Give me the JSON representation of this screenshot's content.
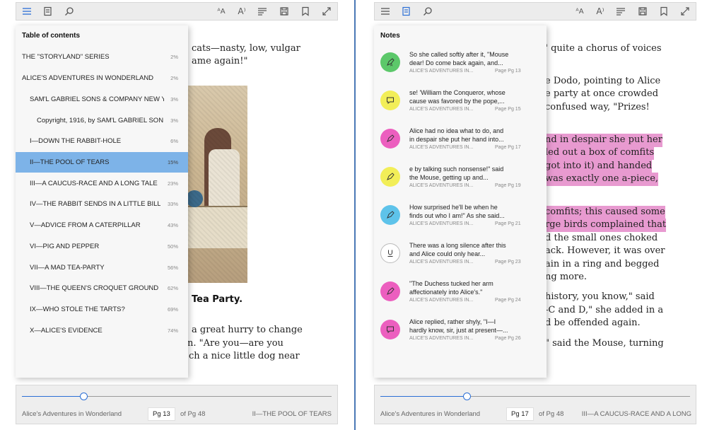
{
  "left": {
    "book_lines": [
      "cats—nasty, low, vulgar",
      "ame again!\""
    ],
    "caption": "Tea Party.",
    "lower_lines": [
      "a great hurry to change",
      "n.  \"Are  you—are  you",
      "ch a nice little dog near"
    ],
    "panel_title": "Table of contents",
    "toc": [
      {
        "label": "THE \"STORYLAND\" SERIES",
        "pct": "2%"
      },
      {
        "label": "ALICE'S ADVENTURES IN WONDERLAND",
        "pct": "2%"
      },
      {
        "label": "SAM'L GABRIEL SONS & COMPANY NEW Y",
        "pct": "3%"
      },
      {
        "label": "Copyright, 1916, by SAM'L GABRIEL SON",
        "pct": "3%"
      },
      {
        "label": "I—DOWN THE RABBIT-HOLE",
        "pct": "6%"
      },
      {
        "label": "II—THE POOL OF TEARS",
        "pct": "15%"
      },
      {
        "label": "III—A CAUCUS-RACE AND A LONG TALE",
        "pct": "23%"
      },
      {
        "label": "IV—THE RABBIT SENDS IN A LITTLE BILL",
        "pct": "33%"
      },
      {
        "label": "V—ADVICE FROM A CATERPILLAR",
        "pct": "43%"
      },
      {
        "label": "VI—PIG AND PEPPER",
        "pct": "50%"
      },
      {
        "label": "VII—A MAD TEA-PARTY",
        "pct": "56%"
      },
      {
        "label": "VIII—THE QUEEN'S CROQUET GROUND",
        "pct": "62%"
      },
      {
        "label": "IX—WHO STOLE THE TARTS?",
        "pct": "69%"
      },
      {
        "label": "X—ALICE'S EVIDENCE",
        "pct": "74%"
      }
    ],
    "footer": {
      "book": "Alice's Adventures in Wonderland",
      "page": "Pg 13",
      "of": "of Pg 48",
      "chapter": "II—THE POOL OF TEARS",
      "progress": 0.2
    }
  },
  "right": {
    "book_lines": [
      "\" quite a chorus of voices",
      "e Dodo, pointing to Alice",
      "e party at once crowded",
      "confused  way,  \"Prizes!",
      "nd in despair she put her",
      "led out a box of comfits",
      "got into it) and handed",
      "was exactly one a-piece,",
      "comfits; this caused some",
      "rge birds complained that",
      "d the small ones choked",
      "ack. However, it was over",
      "ain in a ring and begged",
      "ng more.",
      "history, you know,\" said",
      "-C and D,\" she added in a",
      "d be offended again.",
      "\" said the Mouse, turning"
    ],
    "panel_title": "Notes",
    "notes": [
      {
        "line1": "So she called softly after it, \"Mouse",
        "line2": "dear! Do come back again, and...",
        "book": "ALICE'S ADVENTURES IN...",
        "page": "Page Pg 13",
        "icon": "highlight-pen-icon",
        "color": "#5cc86a"
      },
      {
        "line1": "se! 'William the Conqueror, whose",
        "line2": "cause was favored by the pope,...",
        "book": "ALICE'S ADVENTURES IN...",
        "page": "Page Pg 15",
        "icon": "comment-icon",
        "color": "#f2ee58"
      },
      {
        "line1": " Alice had no idea what to do, and",
        "line2": "in despair she put her hand into...",
        "book": "ALICE'S ADVENTURES IN...",
        "page": "Page Pg 17",
        "icon": "highlight-pen-icon",
        "color": "#ec5fbf"
      },
      {
        "line1": "e by talking such nonsense!\" said",
        "line2": "the Mouse, getting up and...",
        "book": "ALICE'S ADVENTURES IN...",
        "page": "Page Pg 19",
        "icon": "highlight-pen-icon",
        "color": "#f2ee58"
      },
      {
        "line1": "How surprised he'll be when he",
        "line2": "finds out who I am!\" As she said...",
        "book": "ALICE'S ADVENTURES IN...",
        "page": "Page Pg 21",
        "icon": "highlight-pen-icon",
        "color": "#5ec3ea"
      },
      {
        "line1": "There was a long silence after this",
        "line2": "and Alice could only hear...",
        "book": "ALICE'S ADVENTURES IN...",
        "page": "Page Pg 23",
        "icon": "underline-icon",
        "color": "#ffffff"
      },
      {
        "line1": "\"The Duchess tucked her arm",
        "line2": "affectionately into Alice's.\"",
        "book": "ALICE'S ADVENTURES IN...",
        "page": "Page Pg 24",
        "icon": "highlight-pen-icon",
        "color": "#ec5fbf"
      },
      {
        "line1": "Alice replied, rather shyly, \"I—I",
        "line2": "hardly know, sir, just at present—...",
        "book": "ALICE'S ADVENTURES IN...",
        "page": "Page Pg 26",
        "icon": "comment-icon",
        "color": "#ec5fbf"
      }
    ],
    "footer": {
      "book": "Alice's Adventures in Wonderland",
      "page": "Pg 17",
      "of": "of Pg 48",
      "chapter": "III—A CAUCUS-RACE AND A LONG",
      "progress": 0.28
    }
  },
  "toolbar": {
    "icons_left": [
      "list-icon",
      "notes-icon",
      "search-icon"
    ],
    "icons_right": [
      "text-size-icon",
      "read-aloud-icon",
      "text-options-icon",
      "save-icon",
      "bookmark-icon",
      "fullscreen-icon"
    ],
    "text_size_glyph": "ᴬ",
    "read_aloud_glyph": "A⁾"
  },
  "colors": {
    "accent": "#2b6fd6",
    "selected_row": "#7db3e8",
    "highlight": "#e89ad0",
    "divider": "#4a78b6"
  }
}
